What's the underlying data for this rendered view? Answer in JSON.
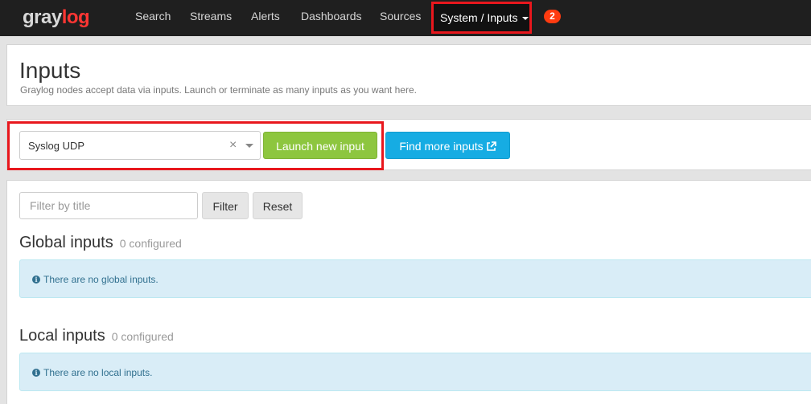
{
  "navbar": {
    "brand_part1": "gray",
    "brand_part2": "log",
    "items": [
      {
        "label": "Search"
      },
      {
        "label": "Streams"
      },
      {
        "label": "Alerts"
      },
      {
        "label": "Dashboards"
      },
      {
        "label": "Sources"
      }
    ],
    "active_item": "System / Inputs",
    "notification_count": "2"
  },
  "header": {
    "title": "Inputs",
    "description": "Graylog nodes accept data via inputs. Launch or terminate as many inputs as you want here."
  },
  "launch": {
    "selected_input": "Syslog UDP",
    "clear_glyph": "×",
    "launch_label": "Launch new input",
    "find_more_label": "Find more inputs"
  },
  "filter": {
    "placeholder": "Filter by title",
    "filter_label": "Filter",
    "reset_label": "Reset"
  },
  "global_inputs": {
    "title": "Global inputs",
    "count": "0 configured",
    "empty_message": "There are no global inputs."
  },
  "local_inputs": {
    "title": "Local inputs",
    "count": "0 configured",
    "empty_message": "There are no local inputs."
  },
  "icons": {
    "external_link": "external-link-icon",
    "info": "info-circle-icon",
    "dropdown": "chevron-down-icon"
  },
  "colors": {
    "brand_red": "#ff3633",
    "highlight_red": "#e8171d",
    "launch_green": "#8dc63f",
    "find_blue": "#16ace3",
    "info_bg": "#d9edf7",
    "info_text": "#31708f"
  }
}
